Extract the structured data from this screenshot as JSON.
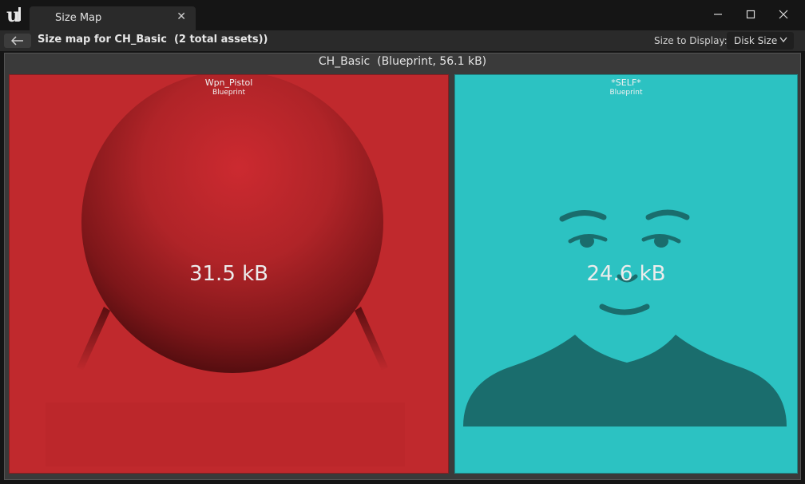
{
  "window": {
    "tab_title": "Size Map",
    "controls": [
      "minimize",
      "maximize",
      "close"
    ]
  },
  "toolbar": {
    "title": "Size map for CH_Basic  (2 total assets))",
    "size_to_display_label": "Size to Display:",
    "size_to_display_value": "Disk Size"
  },
  "size_map": {
    "root_label": "CH_Basic  (Blueprint, 56.1 kB)",
    "nodes": [
      {
        "name": "Wpn_Pistol",
        "type": "Blueprint",
        "size": "31.5 kB",
        "color": "#c0292d"
      },
      {
        "name": "*SELF*",
        "type": "Blueprint",
        "size": "24.6 kB",
        "color": "#2cc2c2"
      }
    ]
  },
  "icons": {
    "app_logo": "unreal-engine-logo",
    "back": "arrow-left-icon",
    "dropdown": "chevron-down-icon"
  }
}
